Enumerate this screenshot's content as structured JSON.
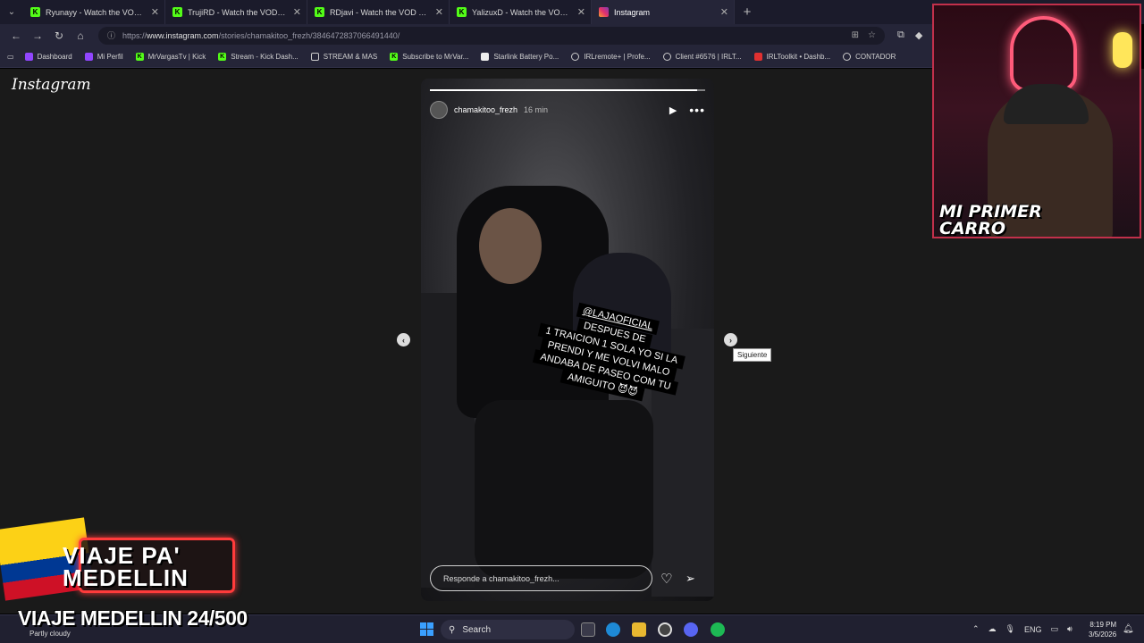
{
  "tabs": [
    {
      "title": "Ryunayy - Watch the VOD on Kick",
      "icon": "kick-icon",
      "active": false
    },
    {
      "title": "TrujiRD - Watch the VOD on Kick",
      "icon": "kick-icon",
      "active": false
    },
    {
      "title": "RDjavi - Watch the VOD on Kick",
      "icon": "kick-icon",
      "active": false
    },
    {
      "title": "YalizuxD - Watch the VOD on Kick",
      "icon": "kick-icon",
      "active": false
    },
    {
      "title": "Instagram",
      "icon": "instagram-icon",
      "active": true
    }
  ],
  "address": {
    "url_prefix": "https://",
    "url_host": "www.instagram.com",
    "url_path": "/stories/chamakitoo_frezh/3846472837066491440/"
  },
  "bookmarks": [
    {
      "label": "Dashboard",
      "icon": "twitch-icon"
    },
    {
      "label": "Mi Perfil",
      "icon": "twitch-icon"
    },
    {
      "label": "MrVargasTv | Kick",
      "icon": "kick-icon"
    },
    {
      "label": "Stream - Kick Dash...",
      "icon": "kick-icon"
    },
    {
      "label": "STREAM & MAS",
      "icon": "folder-icon"
    },
    {
      "label": "Subscribe to MrVar...",
      "icon": "kick-icon"
    },
    {
      "label": "Starlink Battery Po...",
      "icon": "page-icon"
    },
    {
      "label": "IRLremote+ | Profe...",
      "icon": "globe-icon"
    },
    {
      "label": "Client #6576 | IRLT...",
      "icon": "globe-icon"
    },
    {
      "label": "IRLToolkit • Dashb...",
      "icon": "irltoolkit-icon"
    },
    {
      "label": "CONTADOR",
      "icon": "piggy-icon"
    }
  ],
  "instagram": {
    "logo": "Instagram",
    "story": {
      "username": "chamakitoo_frezh",
      "age": "16 min",
      "progress": 0.97,
      "caption_mention": "@LAJAOFICIAL",
      "caption_lines": [
        "DESPUES DE",
        "1 TRAICION 1 SOLA YO SI LA",
        "PRENDI Y ME VOLVI MALO",
        "ANDABA DE PASEO COM TU",
        "AMIGUITO 😈😈"
      ],
      "reply_placeholder": "Responde a chamakitoo_frezh..."
    },
    "next_tooltip": "Siguiente"
  },
  "overlay": {
    "cam_title_line1": "MI PRIMER",
    "cam_title_line2": "CARRO",
    "promo_line1": "VIAJE PA'",
    "promo_line2": "MEDELLIN",
    "goal_text": "VIAJE MEDELLIN 24/500"
  },
  "taskbar": {
    "weather": "Partly cloudy",
    "search_label": "Search",
    "language": "ENG",
    "time": "8:19 PM",
    "date": "3/5/2026"
  },
  "colors": {
    "kick_green": "#53fc18",
    "neon_red": "#ff3b3b"
  }
}
